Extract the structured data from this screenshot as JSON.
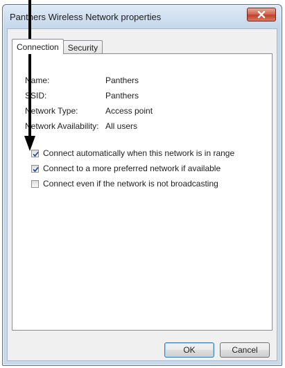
{
  "window": {
    "title": "Panthers Wireless Network properties",
    "close_icon": "close-x-icon"
  },
  "tabs": [
    {
      "label": "Connection",
      "active": true
    },
    {
      "label": "Security",
      "active": false
    }
  ],
  "properties": [
    {
      "label": "Name:",
      "value": "Panthers"
    },
    {
      "label": "SSID:",
      "value": "Panthers"
    },
    {
      "label": "Network Type:",
      "value": "Access point"
    },
    {
      "label": "Network Availability:",
      "value": "All users"
    }
  ],
  "options": [
    {
      "label": "Connect automatically when this network is in range",
      "checked": true
    },
    {
      "label": "Connect to a more preferred network if available",
      "checked": true
    },
    {
      "label": "Connect even if the network is not broadcasting",
      "checked": false
    }
  ],
  "buttons": {
    "ok": "OK",
    "cancel": "Cancel"
  },
  "annotation": {
    "type": "arrow",
    "direction": "down",
    "color": "#000000"
  }
}
